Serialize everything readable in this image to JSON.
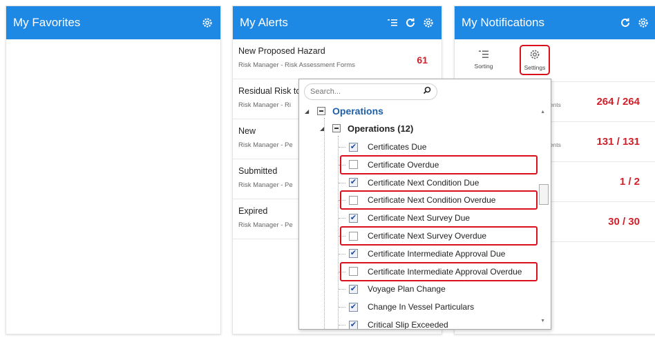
{
  "favorites": {
    "title": "My Favorites"
  },
  "alerts": {
    "title": "My Alerts",
    "items": [
      {
        "title": "New Proposed Hazard",
        "subtitle": "Risk Manager - Risk Assessment Forms",
        "count": "61"
      },
      {
        "title": "Residual Risk to",
        "subtitle": "Risk Manager - Ri",
        "count": ""
      },
      {
        "title": "New",
        "subtitle": "Risk Manager - Pe",
        "count": ""
      },
      {
        "title": "Submitted",
        "subtitle": "Risk Manager - Pe",
        "count": ""
      },
      {
        "title": "Expired",
        "subtitle": "Risk Manager - Pe",
        "count": ""
      }
    ]
  },
  "notifications": {
    "title": "My Notifications",
    "toolbar": {
      "sorting_label": "Sorting",
      "settings_label": "Settings"
    },
    "rows": [
      {
        "label": "uments",
        "count": "264 / 264"
      },
      {
        "label": "uments",
        "count": "131 / 131"
      },
      {
        "label": "",
        "count": "1 / 2"
      },
      {
        "label": "",
        "count": "30 / 30"
      }
    ]
  },
  "popup": {
    "search": {
      "placeholder": "Search..."
    },
    "root": {
      "label": "Operations"
    },
    "group": {
      "label": "Operations (12)"
    },
    "items": [
      {
        "label": "Certificates Due",
        "checked": true,
        "highlight": false
      },
      {
        "label": "Certificate Overdue",
        "checked": false,
        "highlight": true
      },
      {
        "label": "Certificate Next Condition Due",
        "checked": true,
        "highlight": false
      },
      {
        "label": "Certificate Next Condition Overdue",
        "checked": false,
        "highlight": true
      },
      {
        "label": "Certificate Next Survey Due",
        "checked": true,
        "highlight": false
      },
      {
        "label": "Certificate Next Survey Overdue",
        "checked": false,
        "highlight": true
      },
      {
        "label": "Certificate Intermediate Approval Due",
        "checked": true,
        "highlight": false
      },
      {
        "label": "Certificate Intermediate Approval Overdue",
        "checked": false,
        "highlight": true
      },
      {
        "label": "Voyage Plan Change",
        "checked": true,
        "highlight": false
      },
      {
        "label": "Change In Vessel Particulars",
        "checked": true,
        "highlight": false
      },
      {
        "label": "Critical Slip Exceeded",
        "checked": true,
        "highlight": false
      }
    ]
  },
  "colors": {
    "header_blue": "#1e88e5",
    "count_red": "#d0202a",
    "highlight_red": "#d9101c"
  },
  "icons": [
    "gear-icon",
    "list-icon",
    "refresh-icon",
    "sort-icon",
    "search-icon",
    "checkbox-icon",
    "minus-icon",
    "expand-triangle-icon"
  ]
}
